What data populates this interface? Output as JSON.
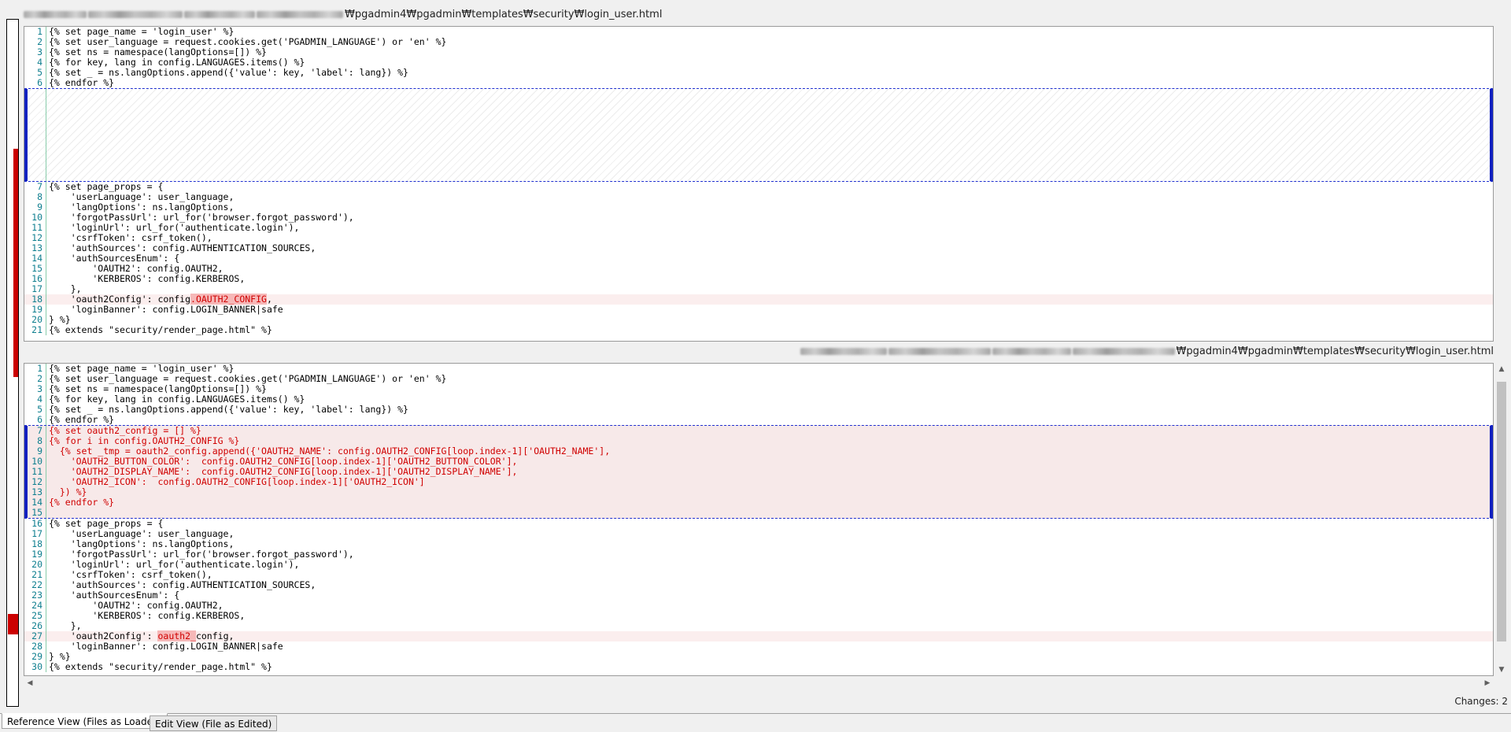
{
  "top_path": "₩pgadmin4₩pgadmin₩templates₩security₩login_user.html",
  "bottom_path": "₩pgadmin4₩pgadmin₩templates₩security₩login_user.html",
  "reference_pane": {
    "lines_before_gap": [
      {
        "n": "1",
        "text": "{% set page_name = 'login_user' %}"
      },
      {
        "n": "2",
        "text": "{% set user_language = request.cookies.get('PGADMIN_LANGUAGE') or 'en' %}"
      },
      {
        "n": "3",
        "text": "{% set ns = namespace(langOptions=[]) %}"
      },
      {
        "n": "4",
        "text": "{% for key, lang in config.LANGUAGES.items() %}"
      },
      {
        "n": "5",
        "text": "{% set _ = ns.langOptions.append({'value': key, 'label': lang}) %}"
      },
      {
        "n": "6",
        "text": "{% endfor %}"
      }
    ],
    "lines_after_gap": [
      {
        "n": "7",
        "text": "{% set page_props = {"
      },
      {
        "n": "8",
        "text": "    'userLanguage': user_language,"
      },
      {
        "n": "9",
        "text": "    'langOptions': ns.langOptions,"
      },
      {
        "n": "10",
        "text": "    'forgotPassUrl': url_for('browser.forgot_password'),"
      },
      {
        "n": "11",
        "text": "    'loginUrl': url_for('authenticate.login'),"
      },
      {
        "n": "12",
        "text": "    'csrfToken': csrf_token(),"
      },
      {
        "n": "13",
        "text": "    'authSources': config.AUTHENTICATION_SOURCES,"
      },
      {
        "n": "14",
        "text": "    'authSourcesEnum': {"
      },
      {
        "n": "15",
        "text": "        'OAUTH2': config.OAUTH2,"
      },
      {
        "n": "16",
        "text": "        'KERBEROS': config.KERBEROS,"
      },
      {
        "n": "17",
        "text": "    },"
      }
    ],
    "changed_line": {
      "n": "18",
      "prefix": "    'oauth2Config': config",
      "highlight": ".OAUTH2_CONFIG",
      "suffix": ","
    },
    "lines_tail": [
      {
        "n": "19",
        "text": "    'loginBanner': config.LOGIN_BANNER|safe"
      },
      {
        "n": "20",
        "text": "} %}"
      },
      {
        "n": "21",
        "text": "{% extends \"security/render_page.html\" %}"
      }
    ]
  },
  "edit_pane": {
    "lines_before_block": [
      {
        "n": "1",
        "text": "{% set page_name = 'login_user' %}"
      },
      {
        "n": "2",
        "text": "{% set user_language = request.cookies.get('PGADMIN_LANGUAGE') or 'en' %}"
      },
      {
        "n": "3",
        "text": "{% set ns = namespace(langOptions=[]) %}"
      },
      {
        "n": "4",
        "text": "{% for key, lang in config.LANGUAGES.items() %}"
      },
      {
        "n": "5",
        "text": "{% set _ = ns.langOptions.append({'value': key, 'label': lang}) %}"
      },
      {
        "n": "6",
        "text": "{% endfor %}"
      }
    ],
    "block_lines": [
      {
        "n": "7",
        "text": "{% set oauth2_config = [] %}"
      },
      {
        "n": "8",
        "text": "{% for i in config.OAUTH2_CONFIG %}"
      },
      {
        "n": "9",
        "text": "  {% set _tmp = oauth2_config.append({'OAUTH2_NAME': config.OAUTH2_CONFIG[loop.index-1]['OAUTH2_NAME'],"
      },
      {
        "n": "10",
        "text": "    'OAUTH2_BUTTON_COLOR':  config.OAUTH2_CONFIG[loop.index-1]['OAUTH2_BUTTON_COLOR'],"
      },
      {
        "n": "11",
        "text": "    'OAUTH2_DISPLAY_NAME':  config.OAUTH2_CONFIG[loop.index-1]['OAUTH2_DISPLAY_NAME'],"
      },
      {
        "n": "12",
        "text": "    'OAUTH2_ICON':  config.OAUTH2_CONFIG[loop.index-1]['OAUTH2_ICON']"
      },
      {
        "n": "13",
        "text": "  }) %}"
      },
      {
        "n": "14",
        "text": "{% endfor %}"
      },
      {
        "n": "15",
        "text": ""
      }
    ],
    "lines_after_block": [
      {
        "n": "16",
        "text": "{% set page_props = {"
      },
      {
        "n": "17",
        "text": "    'userLanguage': user_language,"
      },
      {
        "n": "18",
        "text": "    'langOptions': ns.langOptions,"
      },
      {
        "n": "19",
        "text": "    'forgotPassUrl': url_for('browser.forgot_password'),"
      },
      {
        "n": "20",
        "text": "    'loginUrl': url_for('authenticate.login'),"
      },
      {
        "n": "21",
        "text": "    'csrfToken': csrf_token(),"
      },
      {
        "n": "22",
        "text": "    'authSources': config.AUTHENTICATION_SOURCES,"
      },
      {
        "n": "23",
        "text": "    'authSourcesEnum': {"
      },
      {
        "n": "24",
        "text": "        'OAUTH2': config.OAUTH2,"
      },
      {
        "n": "25",
        "text": "        'KERBEROS': config.KERBEROS,"
      },
      {
        "n": "26",
        "text": "    },"
      }
    ],
    "changed_line": {
      "n": "27",
      "prefix": "    'oauth2Config': ",
      "highlight": "oauth2_",
      "suffix": "config,"
    },
    "lines_tail": [
      {
        "n": "28",
        "text": "    'loginBanner': config.LOGIN_BANNER|safe"
      },
      {
        "n": "29",
        "text": "} %}"
      },
      {
        "n": "30",
        "text": "{% extends \"security/render_page.html\" %}"
      }
    ]
  },
  "changes_label": "Changes: 2",
  "tabs": {
    "reference": "Reference View (Files as Loaded)",
    "edit": "Edit View (File as Edited)"
  },
  "colors": {
    "change_text": "#d00000",
    "change_bg": "#f7e9e9",
    "block_marker": "#1020c0",
    "overview_mark": "#cc0000"
  }
}
